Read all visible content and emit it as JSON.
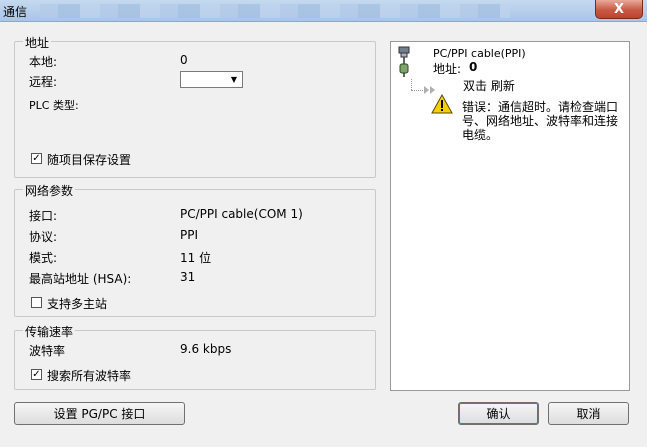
{
  "window": {
    "title": "通信",
    "close_label": "X"
  },
  "address": {
    "legend": "地址",
    "local_label": "本地:",
    "local_value": "0",
    "remote_label": "远程:",
    "remote_value": "",
    "plc_type_label": "PLC 类型:",
    "save_checkbox_label": "随项目保存设置",
    "save_checked": true
  },
  "network": {
    "legend": "网络参数",
    "interface_label": "接口:",
    "interface_value": "PC/PPI cable(COM 1)",
    "protocol_label": "协议:",
    "protocol_value": "PPI",
    "mode_label": "模式:",
    "mode_value": "11 位",
    "hsa_label": "最高站地址 (HSA):",
    "hsa_value": "31",
    "multimaster_label": "支持多主站",
    "multimaster_checked": false
  },
  "baud": {
    "legend": "传输速率",
    "rate_label": "波特率",
    "rate_value": "9.6 kbps",
    "search_label": "搜索所有波特率",
    "search_checked": true
  },
  "device_panel": {
    "cable_name": "PC/PPI cable(PPI)",
    "address_label": "地址:",
    "address_value": "0",
    "refresh_text": "双击 刷新",
    "error_text": "错误：通信超时。请检查端口号、网络地址、波特率和连接电缆。"
  },
  "buttons": {
    "setup_pgpc": "设置 PG/PC 接口",
    "ok": "确认",
    "cancel": "取消"
  }
}
